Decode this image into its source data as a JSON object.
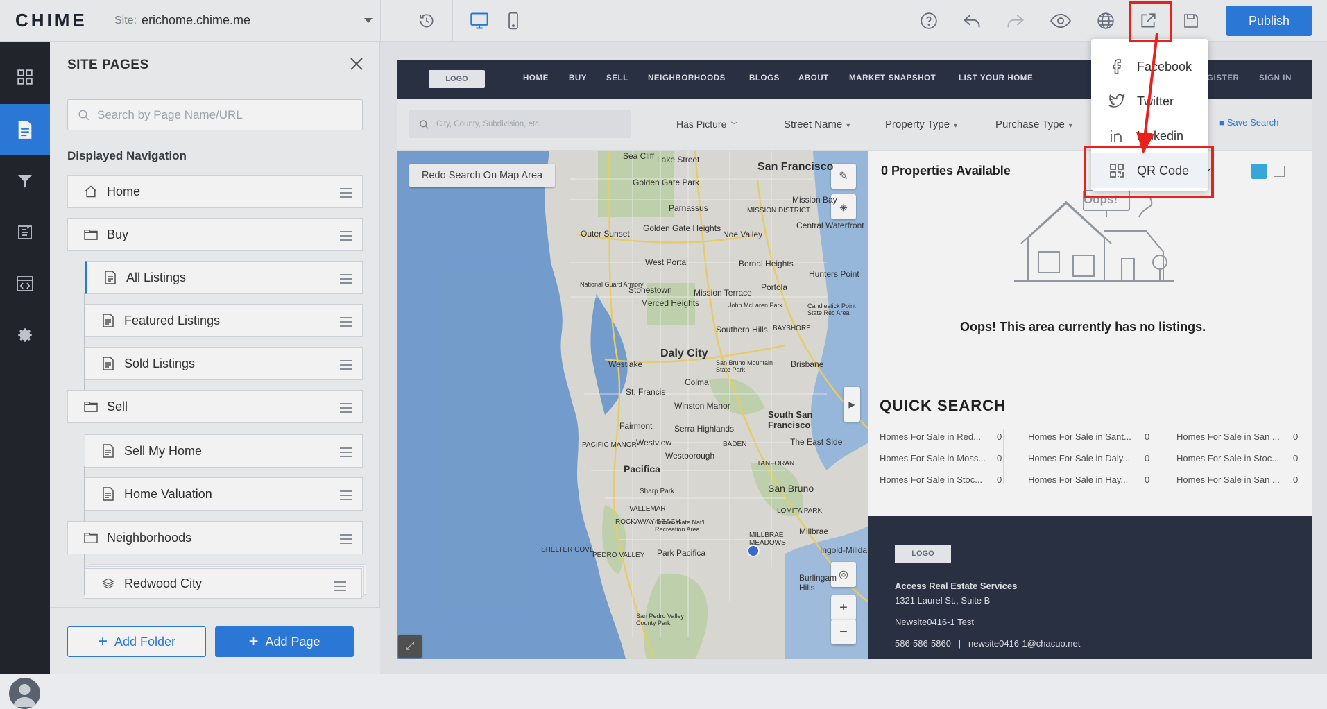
{
  "app": {
    "logo": "CHIME",
    "site_label": "Site:",
    "site_value": "erichome.chime.me",
    "publish": "Publish"
  },
  "panel": {
    "title": "SITE PAGES",
    "search_placeholder": "Search by Page Name/URL",
    "section": "Displayed Navigation",
    "items": [
      {
        "label": "Home",
        "icon": "home-icon"
      },
      {
        "label": "Buy",
        "icon": "folder-icon"
      },
      {
        "label": "All Listings",
        "icon": "page-icon"
      },
      {
        "label": "Featured Listings",
        "icon": "page-icon"
      },
      {
        "label": "Sold Listings",
        "icon": "page-icon"
      },
      {
        "label": "Sell",
        "icon": "folder-icon"
      },
      {
        "label": "Sell My Home",
        "icon": "page-icon"
      },
      {
        "label": "Home Valuation",
        "icon": "page-icon"
      },
      {
        "label": "Neighborhoods",
        "icon": "folder-icon"
      },
      {
        "label": "Redwood City",
        "icon": "layers-icon"
      }
    ],
    "add_folder": "Add Folder",
    "add_page": "Add Page"
  },
  "preview": {
    "logo": "LOGO",
    "nav": [
      "HOME",
      "BUY",
      "SELL",
      "NEIGHBORHOODS",
      "BLOGS",
      "ABOUT",
      "MARKET SNAPSHOT",
      "LIST YOUR HOME",
      "GISTER",
      "SIGN IN"
    ],
    "search_placeholder": "City, County, Subdivision, etc",
    "filters": [
      "Has Picture",
      "Street Name",
      "Property Type",
      "Purchase Type"
    ],
    "save_search": "Save Search",
    "redo": "Redo Search On Map Area",
    "properties": "0 Properties Available",
    "sort": "ult",
    "oops_badge": "Oops!",
    "oops": "Oops! This area currently has no listings.",
    "quick_search": "QUICK SEARCH",
    "quick": [
      {
        "label": "Homes For Sale in Red...",
        "count": "0"
      },
      {
        "label": "Homes For Sale in Sant...",
        "count": "0"
      },
      {
        "label": "Homes For Sale in San ...",
        "count": "0"
      },
      {
        "label": "Homes For Sale in Moss...",
        "count": "0"
      },
      {
        "label": "Homes For Sale in Daly...",
        "count": "0"
      },
      {
        "label": "Homes For Sale in Stoc...",
        "count": "0"
      },
      {
        "label": "Homes For Sale in Stoc...",
        "count": "0"
      },
      {
        "label": "Homes For Sale in Hay...",
        "count": "0"
      },
      {
        "label": "Homes For Sale in San ...",
        "count": "0"
      }
    ],
    "footer": {
      "logo": "LOGO",
      "company": "Access Real Estate Services",
      "address": "1321 Laurel St., Suite B",
      "site": "Newsite0416-1 Test",
      "contact": "586-586-5860   |   newsite0416-1@chacuo.net"
    },
    "map_labels": [
      "Sea Cliff",
      "Lake Street",
      "San Francisco",
      "Golden Gate Park",
      "Parnassus",
      "Mission Bay",
      "Outer Sunset",
      "Golden Gate Heights",
      "Noe Valley",
      "MISSION DISTRICT",
      "Central Waterfront",
      "West Portal",
      "Bernal Heights",
      "Hunters Point",
      "National Guard Armory",
      "Stonestown",
      "Mission Terrace",
      "Portola",
      "Merced Heights",
      "John McLaren Park",
      "Candlestick Point State Rec Area",
      "Southern Hills",
      "BAYSHORE",
      "Daly City",
      "Westlake",
      "San Bruno Mountain State Park",
      "Brisbane",
      "Colma",
      "St. Francis",
      "Winston Manor",
      "Fairmont",
      "Serra Highlands",
      "South San Francisco",
      "Westview",
      "PACIFIC MANOR",
      "The East Side",
      "Westborough",
      "BADEN",
      "Pacifica",
      "TANFORAN",
      "Sharp Park",
      "San Bruno",
      "VALLEMAR",
      "LOMITA PARK",
      "ROCKAWAY BEACH",
      "Golden Gate Nat'l Recreation Area",
      "Millbrae",
      "SHELTER COVE",
      "PEDRO VALLEY",
      "Park Pacifica",
      "MILLBRAE MEADOWS",
      "Ingold-Millda",
      "Burlingam Hills",
      "San Pedro Valley County Park"
    ]
  },
  "share_menu": [
    "Facebook",
    "Twitter",
    "Linkedin",
    "QR Code"
  ],
  "colors": {
    "accent": "#2d7ee2",
    "dark_nav": "#2b3346",
    "highlight": "#e8211c"
  }
}
